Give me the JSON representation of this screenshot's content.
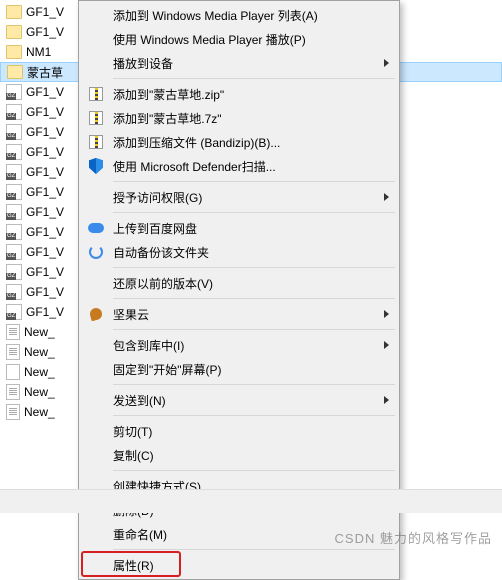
{
  "files": [
    {
      "icon": "folder",
      "name": "GF1_V"
    },
    {
      "icon": "folder",
      "name": "GF1_V"
    },
    {
      "icon": "folder",
      "name": "NM1"
    },
    {
      "icon": "folder",
      "name": "蒙古草",
      "selected": true
    },
    {
      "icon": "gz",
      "name": "GF1_V"
    },
    {
      "icon": "gz",
      "name": "GF1_V"
    },
    {
      "icon": "gz",
      "name": "GF1_V"
    },
    {
      "icon": "gz",
      "name": "GF1_V"
    },
    {
      "icon": "gz",
      "name": "GF1_V"
    },
    {
      "icon": "gz",
      "name": "GF1_V"
    },
    {
      "icon": "gz",
      "name": "GF1_V"
    },
    {
      "icon": "gz",
      "name": "GF1_V"
    },
    {
      "icon": "gz",
      "name": "GF1_V"
    },
    {
      "icon": "gz",
      "name": "GF1_V"
    },
    {
      "icon": "gz",
      "name": "GF1_V"
    },
    {
      "icon": "gz",
      "name": "GF1_V"
    },
    {
      "icon": "txt",
      "name": "New_"
    },
    {
      "icon": "txt",
      "name": "New_"
    },
    {
      "icon": "xml",
      "name": "New_"
    },
    {
      "icon": "txt",
      "name": "New_"
    },
    {
      "icon": "txt",
      "name": "New_"
    }
  ],
  "menu": {
    "groups": [
      [
        {
          "label": "添加到 Windows Media Player 列表(A)",
          "icon": null,
          "submenu": false
        },
        {
          "label": "使用 Windows Media Player 播放(P)",
          "icon": null,
          "submenu": false
        },
        {
          "label": "播放到设备",
          "icon": null,
          "submenu": true
        }
      ],
      [
        {
          "label": "添加到\"蒙古草地.zip\"",
          "icon": "zip",
          "submenu": false
        },
        {
          "label": "添加到\"蒙古草地.7z\"",
          "icon": "zip",
          "submenu": false
        },
        {
          "label": "添加到压缩文件 (Bandizip)(B)...",
          "icon": "zip",
          "submenu": false
        },
        {
          "label": "使用 Microsoft Defender扫描...",
          "icon": "shield",
          "submenu": false
        }
      ],
      [
        {
          "label": "授予访问权限(G)",
          "icon": null,
          "submenu": true
        }
      ],
      [
        {
          "label": "上传到百度网盘",
          "icon": "cloud",
          "submenu": false
        },
        {
          "label": "自动备份该文件夹",
          "icon": "sync",
          "submenu": false
        }
      ],
      [
        {
          "label": "还原以前的版本(V)",
          "icon": null,
          "submenu": false
        }
      ],
      [
        {
          "label": "坚果云",
          "icon": "nut",
          "submenu": true
        }
      ],
      [
        {
          "label": "包含到库中(I)",
          "icon": null,
          "submenu": true
        },
        {
          "label": "固定到\"开始\"屏幕(P)",
          "icon": null,
          "submenu": false
        }
      ],
      [
        {
          "label": "发送到(N)",
          "icon": null,
          "submenu": true
        }
      ],
      [
        {
          "label": "剪切(T)",
          "icon": null,
          "submenu": false
        },
        {
          "label": "复制(C)",
          "icon": null,
          "submenu": false
        }
      ],
      [
        {
          "label": "创建快捷方式(S)",
          "icon": null,
          "submenu": false
        },
        {
          "label": "删除(D)",
          "icon": null,
          "submenu": false
        },
        {
          "label": "重命名(M)",
          "icon": null,
          "submenu": false
        }
      ],
      [
        {
          "label": "属性(R)",
          "icon": null,
          "submenu": false,
          "highlighted": true
        }
      ]
    ]
  },
  "watermark": "CSDN 魅力的风格写作品"
}
